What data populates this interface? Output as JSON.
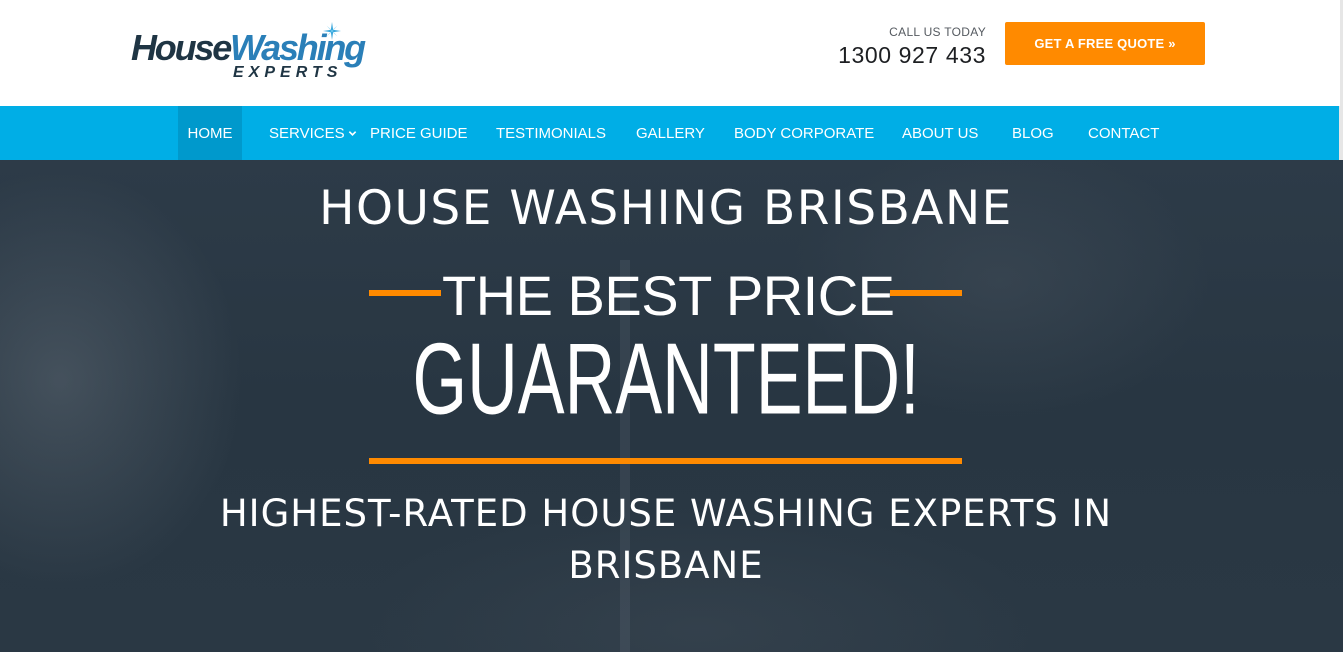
{
  "header": {
    "logo": {
      "text_a": "House",
      "text_b": "Washing",
      "text_sub": "EXPERTS"
    },
    "call_label": "CALL US TODAY",
    "phone": "1300 927 433",
    "quote_button": "GET A FREE QUOTE »"
  },
  "nav": {
    "items": [
      {
        "label": "HOME",
        "active": true
      },
      {
        "label": "SERVICES",
        "has_dropdown": true
      },
      {
        "label": "PRICE GUIDE"
      },
      {
        "label": "TESTIMONIALS"
      },
      {
        "label": "GALLERY"
      },
      {
        "label": "BODY CORPORATE"
      },
      {
        "label": "ABOUT US"
      },
      {
        "label": "BLOG"
      },
      {
        "label": "CONTACT"
      }
    ]
  },
  "hero": {
    "title": "HOUSE WASHING BRISBANE",
    "tagline": "THE BEST PRICE",
    "headline": "GUARANTEED!",
    "subtitle": "HIGHEST-RATED HOUSE WASHING EXPERTS IN BRISBANE"
  },
  "colors": {
    "accent": "#ff8a00",
    "nav_bg": "#00aee6",
    "nav_active": "#0099cc",
    "hero_bg": "#2b3946",
    "logo_dark": "#1f3544",
    "logo_blue": "#2a7fb8"
  },
  "icons": {
    "logo_star": "sparkle-icon",
    "services_dropdown": "chevron-down-icon"
  }
}
